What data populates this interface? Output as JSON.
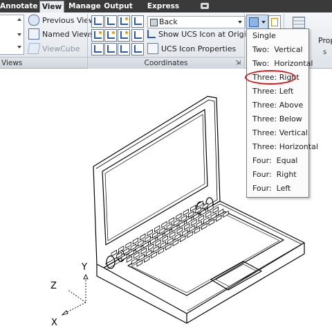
{
  "tabs": [
    {
      "label": "Annotate",
      "active": false
    },
    {
      "label": "View",
      "active": true
    },
    {
      "label": "Manage",
      "active": false
    },
    {
      "label": "Output",
      "active": false
    },
    {
      "label": "Express Tools",
      "active": false
    }
  ],
  "views_panel": {
    "previous_views_label": "Previous Views",
    "named_views_label": "Named Views",
    "viewcube_label": "ViewCube",
    "title": "Views"
  },
  "coordinates_panel": {
    "back_dropdown_value": "Back",
    "show_ucs_icon_label": "Show UCS Icon at Origin",
    "ucs_icon_properties_label": "UCS Icon Properties",
    "title": "Coordinates"
  },
  "properties_label": "Prop",
  "stray_glyph": "s",
  "viewport_menu": {
    "items": [
      "Single",
      "Two:  Vertical",
      "Two:  Horizontal",
      "Three: Right",
      "Three: Left",
      "Three: Above",
      "Three: Below",
      "Three: Vertical",
      "Three: Horizontal",
      "Four:  Equal",
      "Four:  Right",
      "Four:  Left"
    ],
    "highlighted_item": "Three: Right"
  },
  "ucs_axes": {
    "x": "X",
    "y": "Y",
    "z": "Z"
  },
  "colors": {
    "tab_bar": "#3a3a3a",
    "ribbon": "#e4e8ed",
    "highlight_ring": "#d41a1a",
    "accent_blue": "#2d5aa8"
  }
}
